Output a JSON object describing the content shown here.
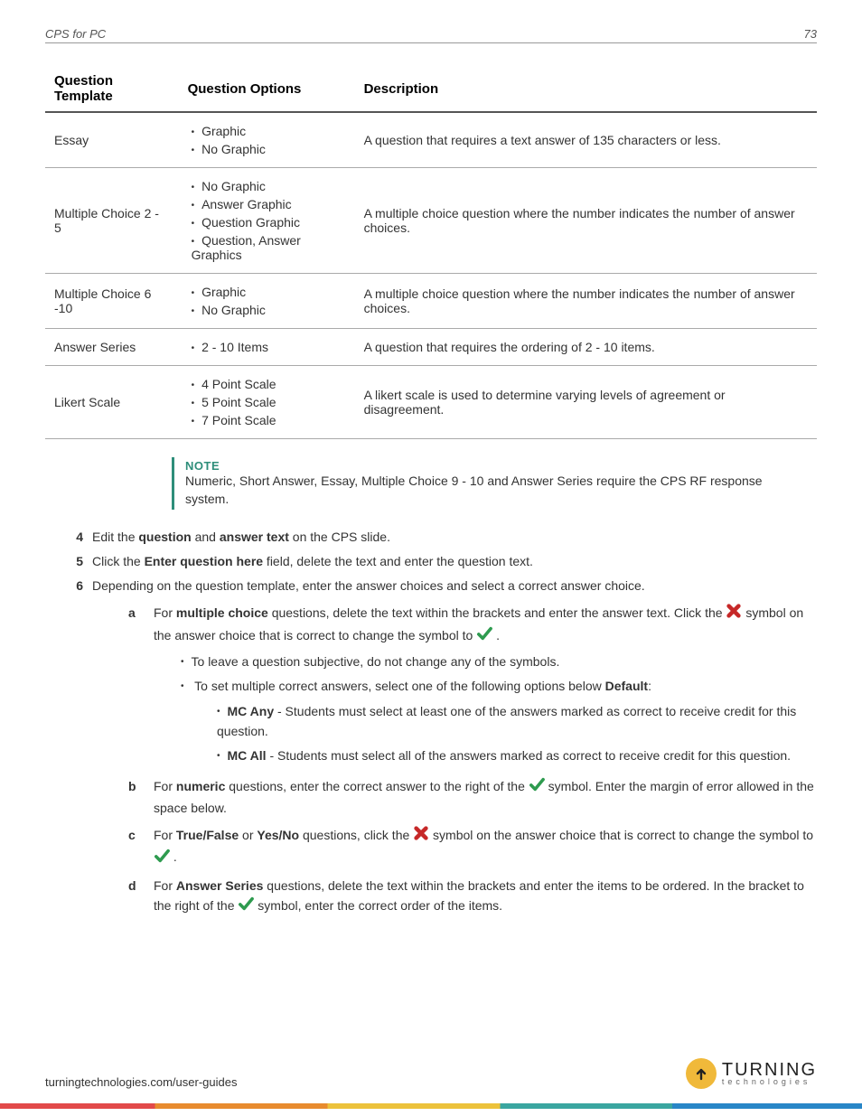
{
  "header": {
    "title": "CPS for PC",
    "page_number": "73"
  },
  "table": {
    "headers": [
      "Question Template",
      "Question Options",
      "Description"
    ],
    "rows": [
      {
        "template": "Essay",
        "options": [
          "Graphic",
          "No Graphic"
        ],
        "description": "A question that requires a text answer of 135 characters or less."
      },
      {
        "template": "Multiple Choice 2 - 5",
        "options": [
          "No Graphic",
          "Answer Graphic",
          "Question Graphic",
          "Question, Answer Graphics"
        ],
        "description": "A multiple choice question where the number indicates the number of answer choices."
      },
      {
        "template": "Multiple Choice 6 -10",
        "options": [
          "Graphic",
          "No Graphic"
        ],
        "description": "A multiple choice question where the number indicates the number of answer choices."
      },
      {
        "template": "Answer Series",
        "options": [
          "2 - 10 Items"
        ],
        "description": "A question that requires the ordering of 2 - 10 items."
      },
      {
        "template": "Likert Scale",
        "options": [
          "4 Point Scale",
          "5 Point Scale",
          "7 Point Scale"
        ],
        "description": "A likert scale is used to determine varying levels of agreement or disagreement."
      }
    ]
  },
  "note": {
    "label": "NOTE",
    "text": "Numeric, Short Answer, Essay, Multiple Choice 9 - 10 and Answer Series require the CPS RF response system."
  },
  "steps": {
    "s4": {
      "num": "4",
      "pre": "Edit the ",
      "b1": "question",
      "mid": " and ",
      "b2": "answer text",
      "post": " on the CPS slide."
    },
    "s5": {
      "num": "5",
      "pre": "Click the ",
      "b1": "Enter question here",
      "post": " field, delete the text and enter the question text."
    },
    "s6": {
      "num": "6",
      "text": "Depending on the question template, enter the answer choices and select a correct answer choice."
    }
  },
  "sub": {
    "a": {
      "num": "a",
      "t1": "For ",
      "b1": "multiple choice",
      "t2": " questions, delete the text within the brackets and enter the answer text. Click the ",
      "t3": " symbol on the answer choice that is correct to change the symbol to ",
      "t4": " .",
      "bul1": "To leave a question subjective, do not change any of the symbols.",
      "bul2a": "To set multiple correct answers, select one of the following options below ",
      "bul2b": "Default",
      "bul2c": ":",
      "mc_any_b": "MC Any",
      "mc_any_t": " - Students must select at least one of the answers marked as correct to receive credit for this question.",
      "mc_all_b": "MC All",
      "mc_all_t": " - Students must select all of the answers marked as correct to receive credit for this question."
    },
    "b": {
      "num": "b",
      "t1": "For ",
      "b1": "numeric",
      "t2": " questions, enter the correct answer to the right of the ",
      "t3": " symbol. Enter the margin of error allowed in the space below."
    },
    "c": {
      "num": "c",
      "t1": "For ",
      "b1": "True/False",
      "t2": " or ",
      "b2": "Yes/No",
      "t3": " questions, click the ",
      "t4": " symbol on the answer choice that is correct to change the symbol to ",
      "t5": " ."
    },
    "d": {
      "num": "d",
      "t1": "For ",
      "b1": "Answer Series",
      "t2": " questions, delete the text within the brackets and enter the items to be ordered. In the bracket to the right of the ",
      "t3": " symbol, enter the correct order of the items."
    }
  },
  "footer": {
    "url": "turningtechnologies.com/user-guides",
    "logo_main": "TURNING",
    "logo_sub": "technologies"
  }
}
